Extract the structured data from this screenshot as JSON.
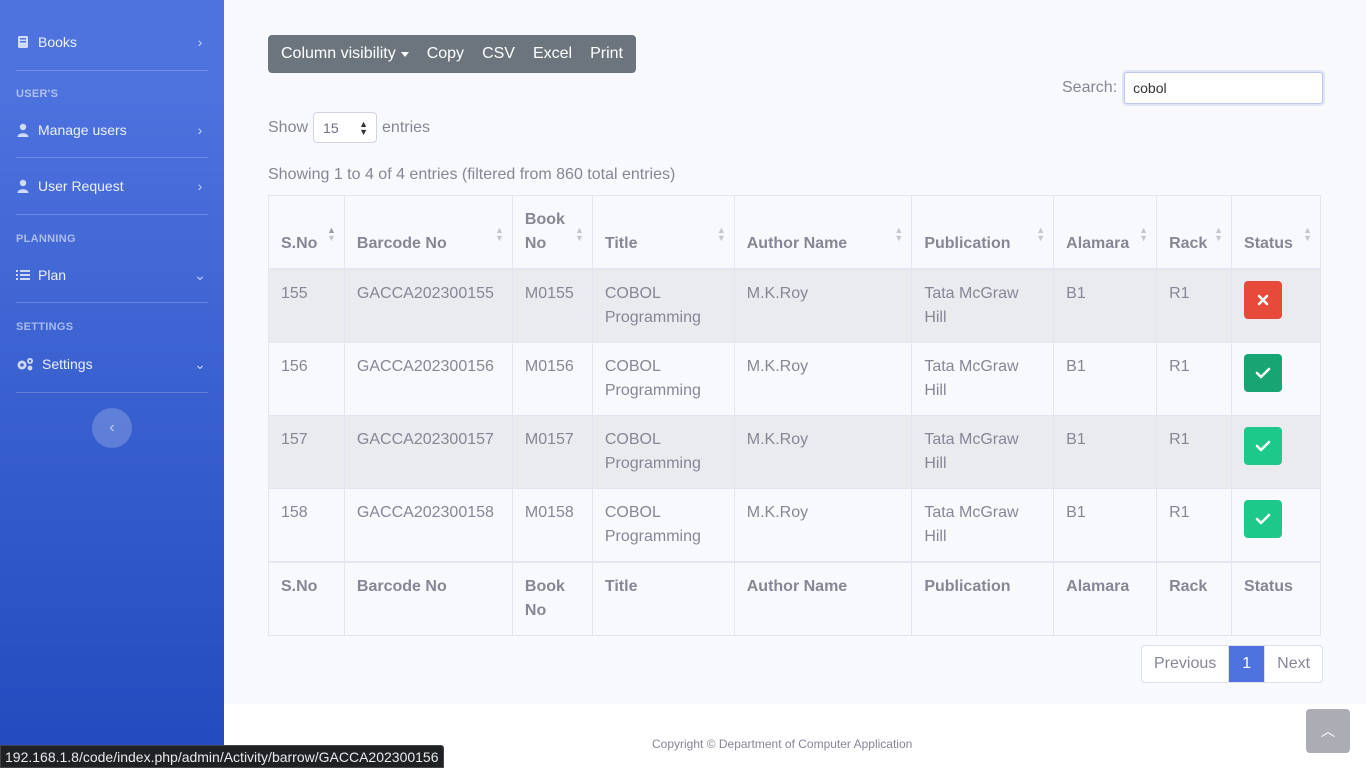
{
  "sidebar": {
    "books": {
      "label": "Books"
    },
    "heading_users": "USER'S",
    "manage_users": {
      "label": "Manage users"
    },
    "user_request": {
      "label": "User Request"
    },
    "heading_planning": "PLANNING",
    "plan": {
      "label": "Plan"
    },
    "heading_settings": "SETTINGS",
    "settings": {
      "label": "Settings"
    }
  },
  "toolbar": {
    "column_visibility": "Column visibility",
    "copy": "Copy",
    "csv": "CSV",
    "excel": "Excel",
    "print": "Print"
  },
  "search": {
    "label": "Search:",
    "value": "cobol"
  },
  "length": {
    "show": "Show",
    "value": "15",
    "entries": "entries"
  },
  "info": "Showing 1 to 4 of 4 entries (filtered from 860 total entries)",
  "table": {
    "headers": [
      "S.No",
      "Barcode No",
      "Book No",
      "Title",
      "Author Name",
      "Publication",
      "Alamara",
      "Rack",
      "Status"
    ],
    "rows": [
      {
        "sno": "155",
        "barcode": "GACCA202300155",
        "book_no": "M0155",
        "title": "COBOL Programming",
        "author": "M.K.Roy",
        "publication": "Tata McGraw Hill",
        "alamara": "B1",
        "rack": "R1",
        "status": "unavailable"
      },
      {
        "sno": "156",
        "barcode": "GACCA202300156",
        "book_no": "M0156",
        "title": "COBOL Programming",
        "author": "M.K.Roy",
        "publication": "Tata McGraw Hill",
        "alamara": "B1",
        "rack": "R1",
        "status": "available"
      },
      {
        "sno": "157",
        "barcode": "GACCA202300157",
        "book_no": "M0157",
        "title": "COBOL Programming",
        "author": "M.K.Roy",
        "publication": "Tata McGraw Hill",
        "alamara": "B1",
        "rack": "R1",
        "status": "available"
      },
      {
        "sno": "158",
        "barcode": "GACCA202300158",
        "book_no": "M0158",
        "title": "COBOL Programming",
        "author": "M.K.Roy",
        "publication": "Tata McGraw Hill",
        "alamara": "B1",
        "rack": "R1",
        "status": "available"
      }
    ]
  },
  "pagination": {
    "previous": "Previous",
    "current": "1",
    "next": "Next"
  },
  "footer": {
    "copyright": "Copyright © Department of Computer Application"
  },
  "status_url": "192.168.1.8/code/index.php/admin/Activity/barrow/GACCA202300156",
  "colors": {
    "sidebar_start": "#4e73df",
    "sidebar_end": "#224abe",
    "danger": "#e74a3b",
    "success": "#1cc88a",
    "success_hover": "#17a673",
    "primary": "#4e73df"
  }
}
